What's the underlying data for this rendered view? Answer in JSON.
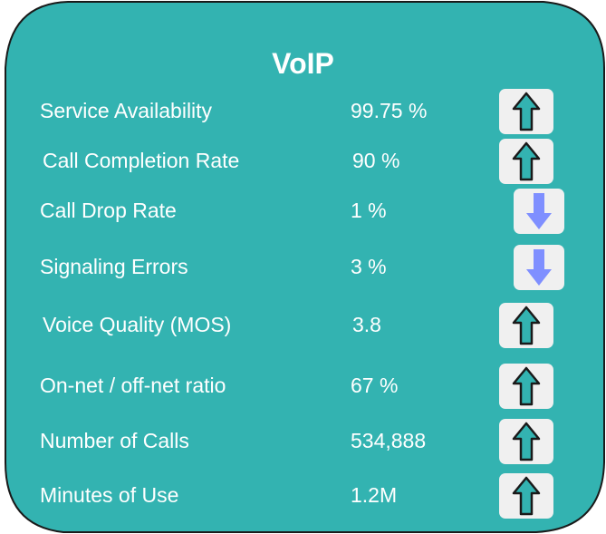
{
  "title": "VoIP",
  "colors": {
    "panel": "#33b3b1",
    "border": "#1a1a1a",
    "tile": "#f0f0f0",
    "up_arrow_fill": "#33b3b1",
    "down_arrow_fill": "#7f8fff"
  },
  "metrics": [
    {
      "label": "Service Availability",
      "value": "99.75 %",
      "trend": "up",
      "icon": "arrow-up-icon"
    },
    {
      "label": "Call Completion Rate",
      "value": "90 %",
      "trend": "up",
      "icon": "arrow-up-icon"
    },
    {
      "label": "Call Drop Rate",
      "value": "1 %",
      "trend": "down",
      "icon": "arrow-down-icon"
    },
    {
      "label": "Signaling Errors",
      "value": "3 %",
      "trend": "down",
      "icon": "arrow-down-icon"
    },
    {
      "label": "Voice Quality (MOS)",
      "value": "3.8",
      "trend": "up",
      "icon": "arrow-up-icon"
    },
    {
      "label": "On-net / off-net ratio",
      "value": "67 %",
      "trend": "up",
      "icon": "arrow-up-icon"
    },
    {
      "label": "Number of Calls",
      "value": "534,888",
      "trend": "up",
      "icon": "arrow-up-icon"
    },
    {
      "label": "Minutes of Use",
      "value": "1.2M",
      "trend": "up",
      "icon": "arrow-up-icon"
    }
  ]
}
